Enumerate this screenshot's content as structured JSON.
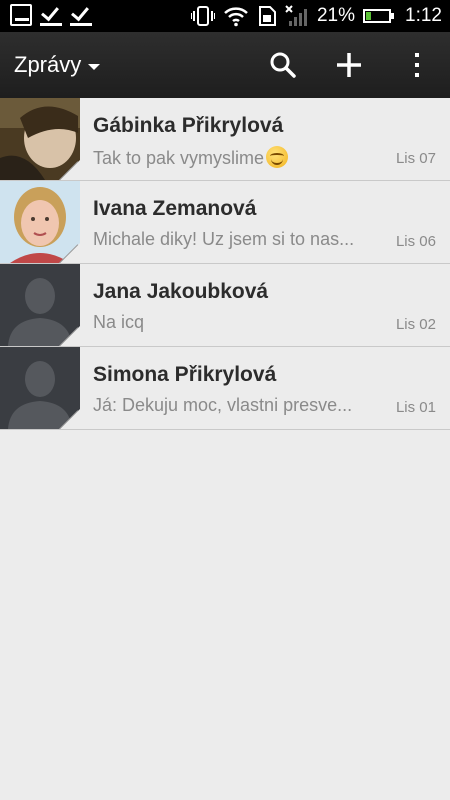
{
  "statusbar": {
    "battery_text": "21%",
    "time": "1:12",
    "battery_level": 0.21,
    "icons": [
      "image-icon",
      "check-icon",
      "check-icon",
      "vibrate-icon",
      "wifi-icon",
      "sim-icon",
      "signal-icon",
      "battery-icon"
    ]
  },
  "actionbar": {
    "title": "Zprávy",
    "icons": [
      "search-icon",
      "plus-icon",
      "overflow-menu-icon"
    ]
  },
  "conversations": [
    {
      "name": "Gábinka Přikrylová",
      "preview": "Tak to pak vymyslime",
      "has_emoji": true,
      "date": "Lis 07",
      "avatar": "photo"
    },
    {
      "name": "Ivana Zemanová",
      "preview": "Michale diky! Uz jsem si to nas...",
      "date": "Lis 06",
      "avatar": "photo"
    },
    {
      "name": "Jana Jakoubková",
      "preview": "Na icq",
      "date": "Lis 02",
      "avatar": "default-contact-icon"
    },
    {
      "name": "Simona Přikrylová",
      "preview": "Já: Dekuju moc, vlastni presve...",
      "date": "Lis 01",
      "avatar": "default-contact-icon"
    }
  ],
  "colors": {
    "statusbar_bg": "#000000",
    "actionbar_bg": "#262626",
    "list_bg": "#ececec",
    "name_text": "#2c2c2c",
    "secondary_text": "#8a8a8a",
    "battery_fill": "#5bc236"
  }
}
